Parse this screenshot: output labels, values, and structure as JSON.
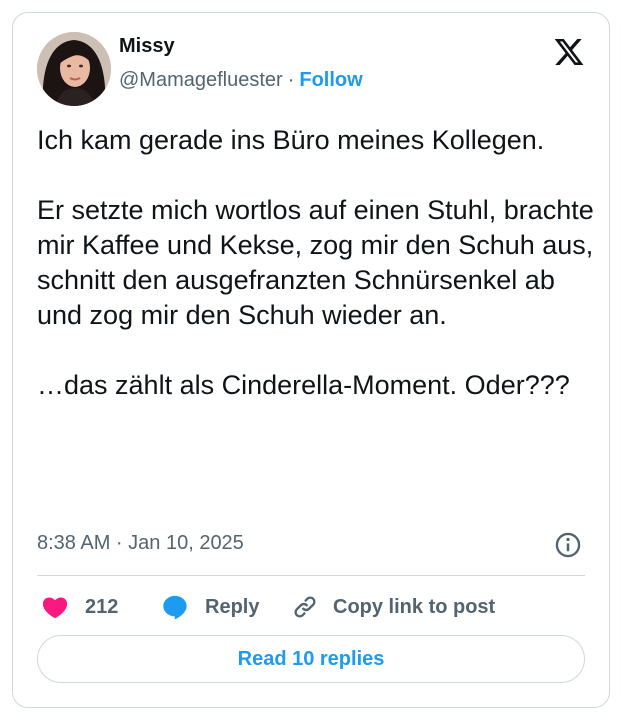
{
  "author": {
    "name": "Missy",
    "handle": "@Mamagefluester",
    "separator": "·",
    "follow_label": "Follow"
  },
  "tweet": {
    "paragraphs": [
      "Ich kam gerade ins Büro meines Kollegen.",
      "Er setzte mich wortlos auf einen Stuhl, brachte mir Kaffee und Kekse, zog mir den Schuh aus, schnitt den ausgefranzten Schnürsenkel ab und zog mir den Schuh wieder an.",
      "…das zählt als Cinderella-Moment. Oder???"
    ],
    "timestamp": "8:38 AM · Jan 10, 2025"
  },
  "actions": {
    "like_count": "212",
    "reply_label": "Reply",
    "copy_label": "Copy link to post"
  },
  "read_replies_label": "Read 10 replies",
  "icons": {
    "platform": "x-logo-icon",
    "info": "info-icon",
    "like": "heart-icon",
    "reply": "speech-bubble-icon",
    "copy": "link-icon"
  },
  "colors": {
    "accent": "#1d9bf0",
    "like": "#f91880",
    "text": "#0f1419",
    "secondary_text": "#536471",
    "border": "#cfd9de"
  }
}
